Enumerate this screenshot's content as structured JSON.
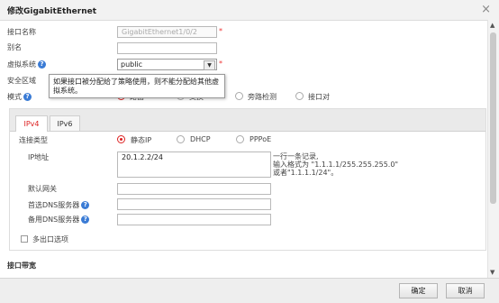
{
  "dialog": {
    "title": "修改GigabitEthernet",
    "close_glyph": "×"
  },
  "form": {
    "if_name_label": "接口名称",
    "if_name_value": "GigabitEthernet1/0/2",
    "alias_label": "别名",
    "alias_value": "",
    "vsys_label": "虚拟系统",
    "vsys_value": "public",
    "zone_label": "安全区域",
    "mode_label": "模式",
    "mode_options": [
      "路由",
      "交换",
      "旁路检测",
      "接口对"
    ],
    "mode_selected": 0,
    "required_mark": "*",
    "help_glyph": "?"
  },
  "tooltip": {
    "text": "如果接口被分配给了策略使用，则不能分配给其他虚拟系统。"
  },
  "tabs": [
    {
      "label": "IPv4"
    },
    {
      "label": "IPv6"
    }
  ],
  "ipv4": {
    "conn_type_label": "连接类型",
    "conn_types": [
      "静态IP",
      "DHCP",
      "PPPoE"
    ],
    "conn_selected": 0,
    "ip_label": "IP地址",
    "ip_value": "20.1.2.2/24",
    "ip_hint_1": "一行一条记录,",
    "ip_hint_2": "输入格式为 \"1.1.1.1/255.255.255.0\"",
    "ip_hint_3": "或者\"1.1.1.1/24\"。",
    "gateway_label": "默认网关",
    "gateway_value": "",
    "dns1_label": "首选DNS服务器",
    "dns1_value": "",
    "dns2_label": "备用DNS服务器",
    "dns2_value": "",
    "multi_exit_label": "多出口选项"
  },
  "bandwidth_section": "接口带宽",
  "footer": {
    "ok_label": "确定",
    "cancel_label": "取消"
  },
  "colors": {
    "accent": "#d22222",
    "help": "#3a7bd5"
  }
}
